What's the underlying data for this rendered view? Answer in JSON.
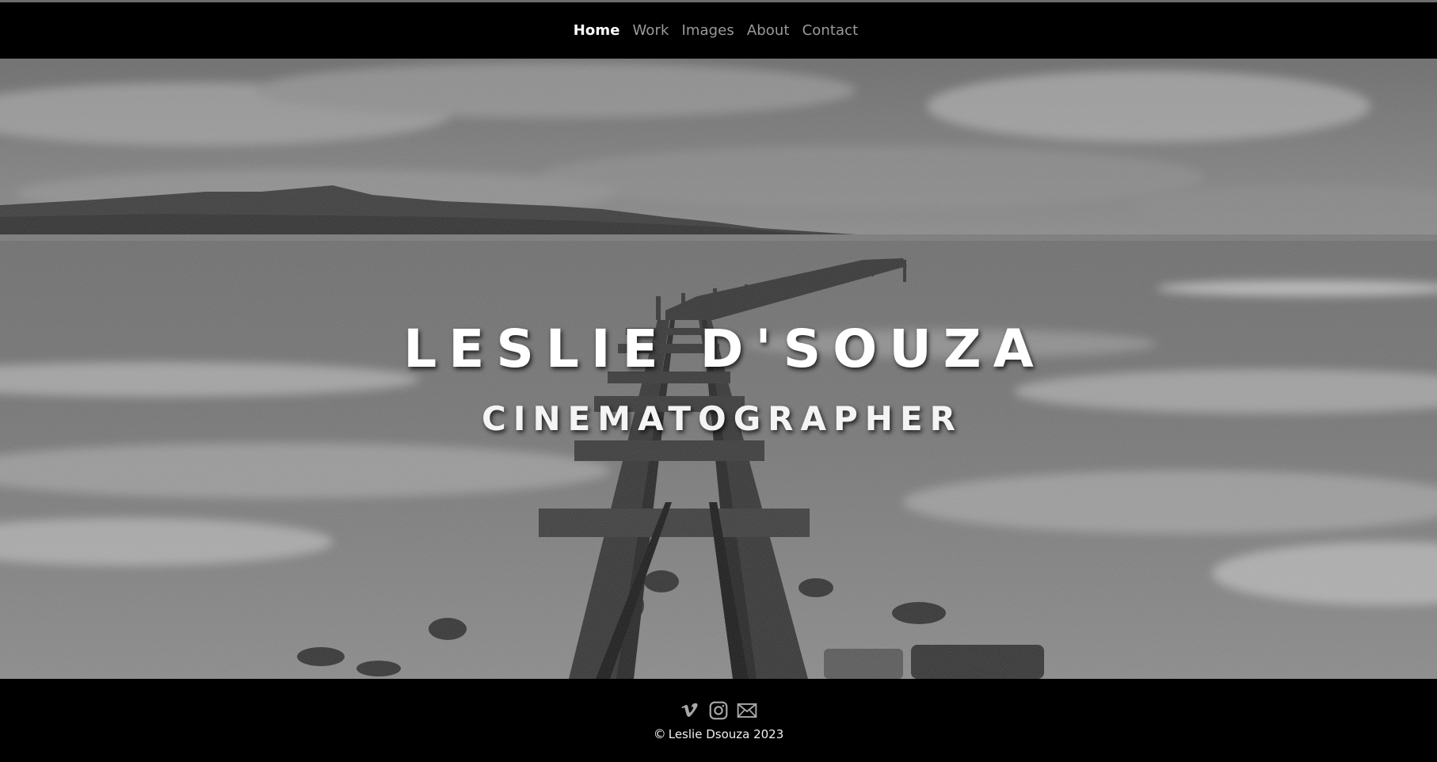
{
  "nav": {
    "items": [
      {
        "label": "Home",
        "active": true
      },
      {
        "label": "Work",
        "active": false
      },
      {
        "label": "Images",
        "active": false
      },
      {
        "label": "About",
        "active": false
      },
      {
        "label": "Contact",
        "active": false
      }
    ]
  },
  "hero": {
    "title": "LESLIE D'SOUZA",
    "subtitle": "CINEMATOGRAPHER",
    "background_image": "black-and-white photo of a broken wooden pier stretching into a stormy sea with hills on the horizon"
  },
  "footer": {
    "social_icons": [
      "vimeo-icon",
      "instagram-icon",
      "email-icon"
    ],
    "copyright_symbol": "©",
    "copyright_text": "Leslie Dsouza 2023"
  },
  "colors": {
    "nav_background": "#000000",
    "nav_inactive": "#9a9a9a",
    "nav_active": "#ffffff",
    "footer_background": "#000000"
  }
}
